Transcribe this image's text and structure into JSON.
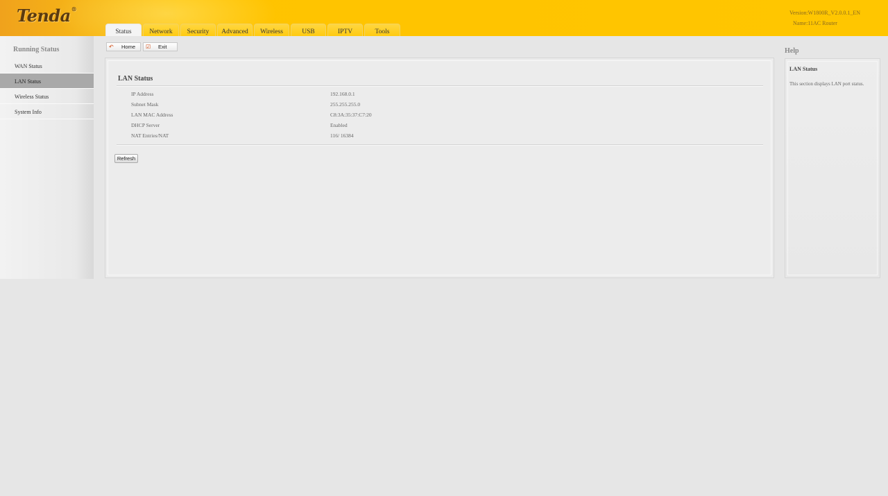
{
  "brand": {
    "logo_text": "Tenda",
    "logo_mark": "®"
  },
  "header": {
    "version": "Version:W1800R_V2.0.0.1_EN",
    "name": "Name:11AC Router"
  },
  "tabs": [
    {
      "label": "Status",
      "active": true
    },
    {
      "label": "Network"
    },
    {
      "label": "Security"
    },
    {
      "label": "Advanced"
    },
    {
      "label": "Wireless"
    },
    {
      "label": "USB"
    },
    {
      "label": "IPTV"
    },
    {
      "label": "Tools"
    }
  ],
  "sidebar": {
    "title": "Running Status",
    "items": [
      {
        "label": "WAN Status"
      },
      {
        "label": "LAN Status",
        "active": true
      },
      {
        "label": "Wireless Status"
      },
      {
        "label": "System Info"
      }
    ]
  },
  "toolbar": {
    "home_label": "Home",
    "exit_label": "Exit",
    "home_icon": "home-arrow-icon",
    "exit_icon": "exit-icon"
  },
  "main": {
    "title": "LAN Status",
    "rows": [
      {
        "label": "IP Address",
        "value": "192.168.0.1"
      },
      {
        "label": "Subnet Mask",
        "value": "255.255.255.0"
      },
      {
        "label": "LAN MAC Address",
        "value": "C8:3A:35:37:C7:20"
      },
      {
        "label": "DHCP Server",
        "value": "Enabled"
      },
      {
        "label": "NAT Entries/NAT",
        "value": "116/ 16384"
      }
    ],
    "refresh_label": "Refresh"
  },
  "help": {
    "title": "Help",
    "heading": "LAN Status",
    "text": "This section displays LAN port status."
  },
  "colors": {
    "accent": "#ffc600",
    "active_sidebar": "#a9a9a9",
    "background": "#e6e6e6"
  }
}
